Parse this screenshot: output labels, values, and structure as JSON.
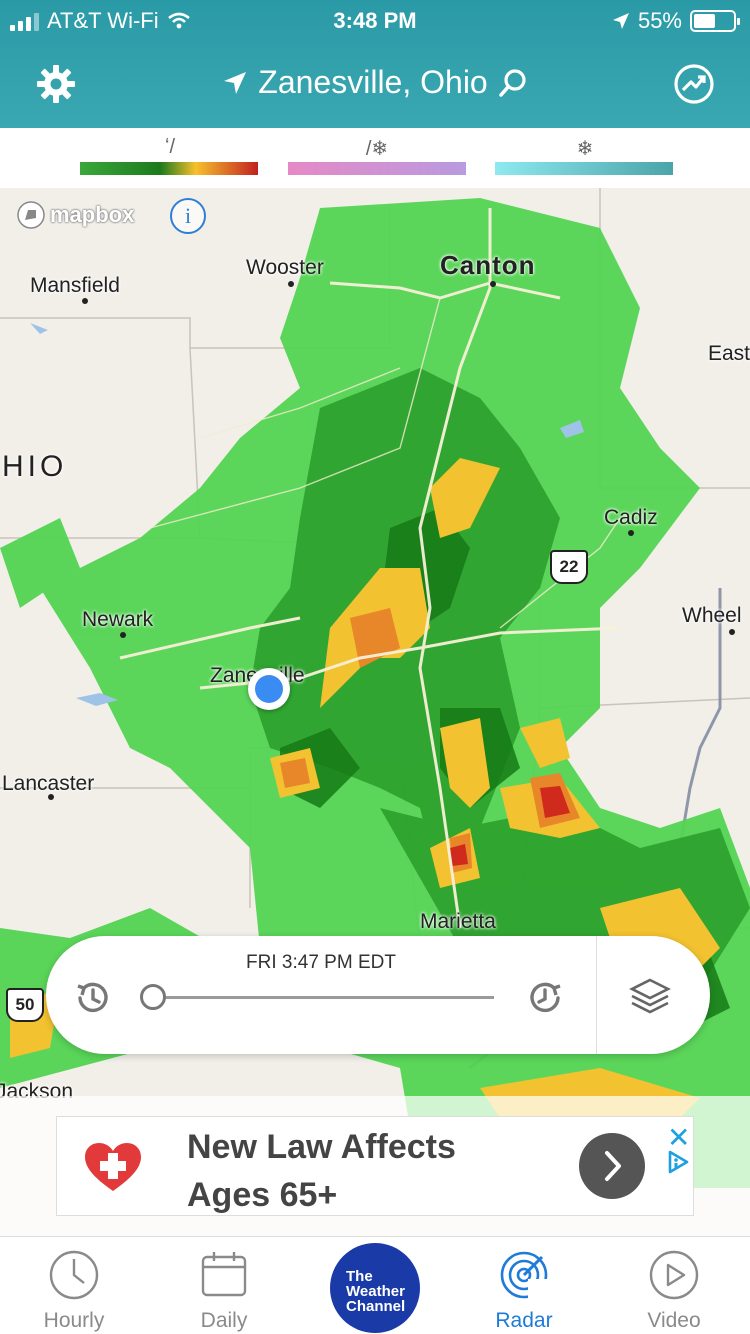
{
  "status_bar": {
    "carrier": "AT&T Wi-Fi",
    "time": "3:48 PM",
    "battery": "55%",
    "battery_level": 0.55
  },
  "header": {
    "location": "Zanesville, Ohio",
    "icons": [
      "gear-icon",
      "location-arrow-icon",
      "search-icon",
      "share-trend-icon"
    ]
  },
  "legend": {
    "items": [
      {
        "icon": "rain-icon",
        "colors": [
          "#3aa83a",
          "#1c7a1c",
          "#f6c02c",
          "#c22020"
        ]
      },
      {
        "icon": "mix-icon",
        "colors": [
          "#e58ac5",
          "#b99ae0"
        ]
      },
      {
        "icon": "snow-icon",
        "colors": [
          "#8ee9f0",
          "#4aa4a8"
        ]
      }
    ]
  },
  "map": {
    "attribution": "mapbox",
    "info_label": "i",
    "state_label": "HIO",
    "cities": {
      "wooster": "Wooster",
      "canton": "Canton",
      "mansfield": "Mansfield",
      "east": "East",
      "cadiz": "Cadiz",
      "newark": "Newark",
      "wheel": "Wheel",
      "zanesville": "Zanesville",
      "lancaster": "Lancaster",
      "marietta": "Marietta",
      "jackson": "Jackson"
    },
    "shields": {
      "us22": "22",
      "us50": "50"
    }
  },
  "player": {
    "timestamp": "FRI 3:47 PM EDT",
    "progress": 0.0
  },
  "ad": {
    "text_line1": "New Law Affects",
    "text_line2": "Ages 65+",
    "close_label": "✕"
  },
  "tabs": {
    "hourly": "Hourly",
    "daily": "Daily",
    "logo_line1": "The",
    "logo_line2": "Weather",
    "logo_line3": "Channel",
    "radar": "Radar",
    "video": "Video",
    "active": "Radar"
  }
}
